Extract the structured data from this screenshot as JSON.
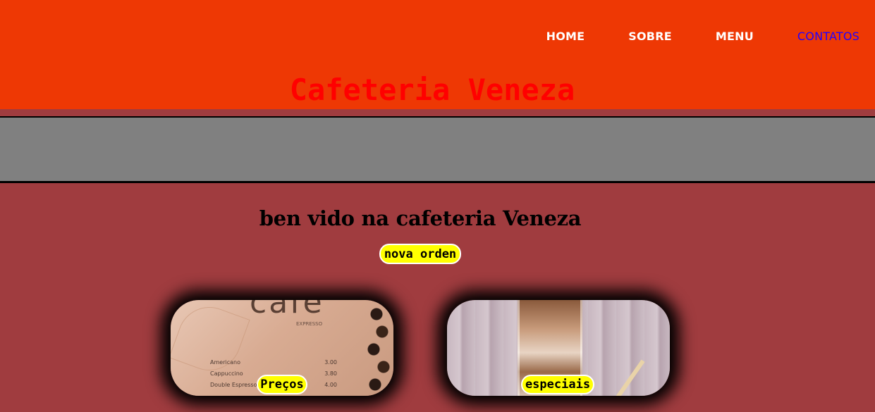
{
  "header": {
    "nav": [
      {
        "label": "HOME",
        "active": false
      },
      {
        "label": "SOBRE",
        "active": false
      },
      {
        "label": "MENU",
        "active": false
      },
      {
        "label": "CONTATOS",
        "active": true
      }
    ],
    "title": "Cafeteria Veneza"
  },
  "main": {
    "welcome": "ben vido na cafeteria Veneza",
    "order_button": "nova orden",
    "cards": [
      {
        "label": "Preços",
        "image": "coffee-menu-photo"
      },
      {
        "label": "especiais",
        "image": "iced-coffee-photo"
      }
    ],
    "menu_photo": {
      "logo": "café",
      "subtitle": "EXPRESSO",
      "rows": [
        {
          "item": "Americano",
          "price": "3.00"
        },
        {
          "item": "Cappuccino",
          "price": "3.80"
        },
        {
          "item": "Double Espresso",
          "price": "4.00"
        }
      ]
    }
  },
  "colors": {
    "header_bg": "#ee3804",
    "page_bg": "#a03c3f",
    "banner_bg": "#808080",
    "title": "#ff0000",
    "active_nav": "#2200ff",
    "button_bg": "#ffff00"
  }
}
